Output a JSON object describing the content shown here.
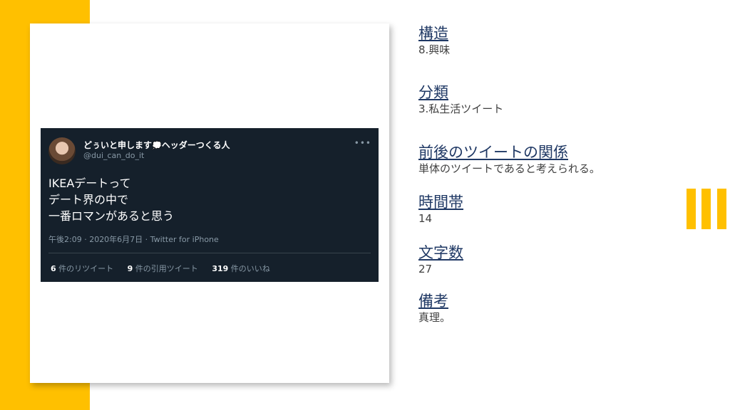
{
  "tweet": {
    "display_name": "どぅいと申します",
    "display_name_suffix": "ヘッダーつくる人",
    "handle": "@dui_can_do_it",
    "more_icon": "more-horizontal-icon",
    "lines": [
      "IKEAデートって",
      "デート界の中で",
      "一番ロマンがあると思う"
    ],
    "meta": "午後2:09 · 2020年6月7日 · Twitter for iPhone",
    "retweets_count": "6",
    "retweets_label": "件のリツイート",
    "quotes_count": "9",
    "quotes_label": "件の引用ツイート",
    "likes_count": "319",
    "likes_label": "件のいいね"
  },
  "sections": [
    {
      "heading": "構造",
      "value": "8.興味"
    },
    {
      "heading": "分類",
      "value": "3.私生活ツイート"
    },
    {
      "heading": "前後のツイートの関係",
      "value": "単体のツイートであると考えられる。"
    },
    {
      "heading": "時間帯",
      "value": "14"
    },
    {
      "heading": "文字数",
      "value": "27"
    },
    {
      "heading": "備考",
      "value": "真理。"
    }
  ],
  "colors": {
    "accent": "#FFC000",
    "heading": "#1f3864",
    "tweet_bg": "#15202b"
  }
}
